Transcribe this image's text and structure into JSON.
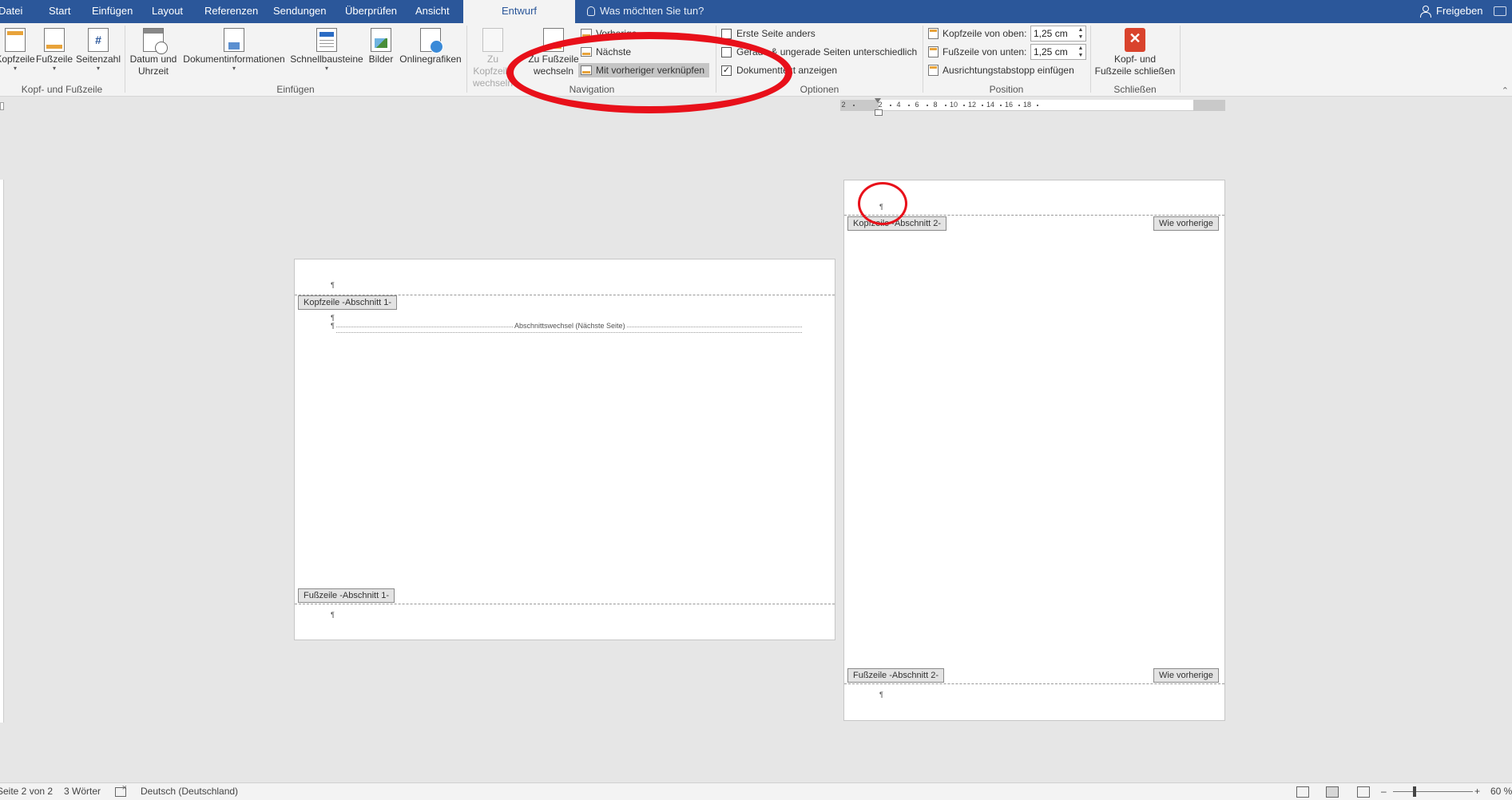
{
  "menu": {
    "tabs": [
      "Datei",
      "Start",
      "Einfügen",
      "Layout",
      "Referenzen",
      "Sendungen",
      "Überprüfen",
      "Ansicht"
    ],
    "active_tab": "Entwurf",
    "tell_me": "Was möchten Sie tun?",
    "share": "Freigeben"
  },
  "ribbon": {
    "kopf_fuss": {
      "kopfzeile": "Kopfzeile",
      "fusszeile": "Fußzeile",
      "seitenzahl": "Seitenzahl",
      "group_label": "Kopf- und Fußzeile"
    },
    "einfuegen": {
      "datum_line1": "Datum und",
      "datum_line2": "Uhrzeit",
      "dokumentinfo": "Dokumentinformationen",
      "schnellbausteine": "Schnellbausteine",
      "bilder": "Bilder",
      "onlinegrafiken": "Onlinegrafiken",
      "group_label": "Einfügen"
    },
    "navigation": {
      "zu_kopfzeile_line1": "Zu Kopfzeile",
      "zu_kopfzeile_line2": "wechseln",
      "zu_fusszeile_line1": "Zu Fußzeile",
      "zu_fusszeile_line2": "wechseln",
      "vorherige": "Vorherige",
      "naechste": "Nächste",
      "verknuepfen": "Mit vorheriger verknüpfen",
      "group_label": "Navigation"
    },
    "optionen": {
      "erste_seite": "Erste Seite anders",
      "gerade_ungerade": "Gerade & ungerade Seiten unterschiedlich",
      "dokumenttext": "Dokumenttext anzeigen",
      "erste_seite_checked": false,
      "gerade_ungerade_checked": false,
      "dokumenttext_checked": true,
      "check_mark": "✓",
      "group_label": "Optionen"
    },
    "position": {
      "kopf_label": "Kopfzeile von oben:",
      "kopf_value": "1,25 cm",
      "fuss_label": "Fußzeile von unten:",
      "fuss_value": "1,25 cm",
      "tab_stop": "Ausrichtungstabstopp einfügen",
      "group_label": "Position"
    },
    "schliessen": {
      "line1": "Kopf- und",
      "line2": "Fußzeile schließen",
      "group_label": "Schließen"
    }
  },
  "ruler": {
    "labels": [
      "2",
      "2",
      "4",
      "6",
      "8",
      "10",
      "12",
      "14",
      "16",
      "18"
    ]
  },
  "page1": {
    "header_tag": "Kopfzeile -Abschnitt 1-",
    "footer_tag": "Fußzeile -Abschnitt 1-",
    "section_break": "Abschnittswechsel (Nächste Seite)",
    "pilcrow": "¶"
  },
  "page2": {
    "header_tag": "Kopfzeile -Abschnitt 2-",
    "footer_tag": "Fußzeile -Abschnitt 2-",
    "same_as_previous": "Wie vorherige",
    "pilcrow": "¶"
  },
  "status": {
    "page": "Seite 2 von 2",
    "words": "3 Wörter",
    "language": "Deutsch (Deutschland)",
    "zoom": "60 %"
  },
  "colors": {
    "title_bar": "#2b579a",
    "annotation": "#e8101a",
    "header_accent": "#e8a33a"
  }
}
